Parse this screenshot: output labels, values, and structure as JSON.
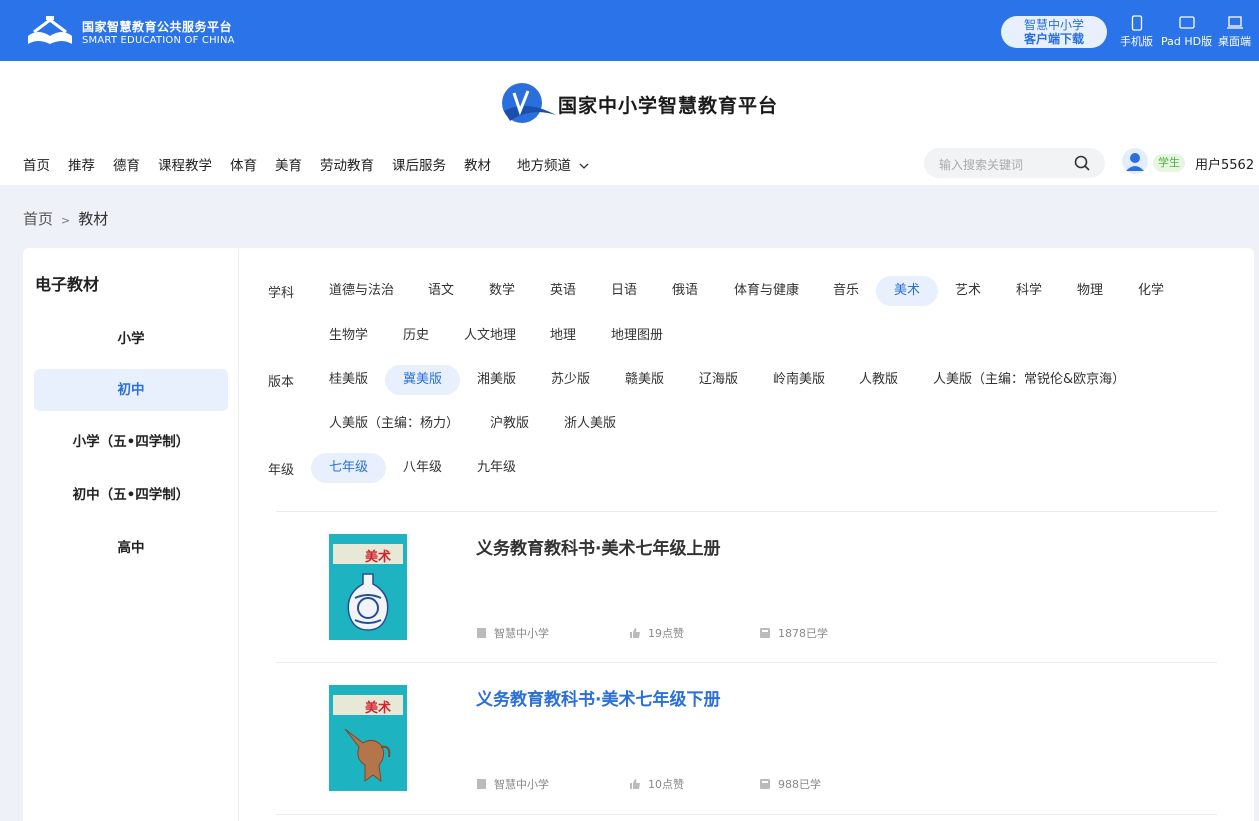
{
  "topbar": {
    "brand_cn": "国家智慧教育公共服务平台",
    "brand_en": "SMART EDUCATION OF CHINA",
    "download_line1": "智慧中小学",
    "download_line2": "客户端下载",
    "devices": [
      {
        "label": "手机版",
        "icon": "phone-icon"
      },
      {
        "label": "Pad HD版",
        "icon": "tablet-icon"
      },
      {
        "label": "桌面端",
        "icon": "laptop-icon"
      }
    ],
    "bg_color": "#2a73e8"
  },
  "header": {
    "title": "国家中小学智慧教育平台",
    "nav": [
      "首页",
      "推荐",
      "德育",
      "课程教学",
      "体育",
      "美育",
      "劳动教育",
      "课后服务",
      "教材",
      "地方频道"
    ],
    "search_placeholder": "输入搜索关键词",
    "role": "学生",
    "username": "用户5562"
  },
  "breadcrumb": {
    "home": "首页",
    "sep": ">",
    "current": "教材"
  },
  "sidebar": {
    "title": "电子教材",
    "items": [
      {
        "label": "小学",
        "active": false
      },
      {
        "label": "初中",
        "active": true
      },
      {
        "label": "小学（五•四学制）",
        "active": false
      },
      {
        "label": "初中（五•四学制）",
        "active": false
      },
      {
        "label": "高中",
        "active": false
      }
    ]
  },
  "filters": {
    "subject_label": "学科",
    "subjects_row1": [
      "道德与法治",
      "语文",
      "数学",
      "英语",
      "日语",
      "俄语",
      "体育与健康",
      "音乐",
      "美术",
      "艺术",
      "科学",
      "物理",
      "化学"
    ],
    "subjects_row2": [
      "生物学",
      "历史",
      "人文地理",
      "地理",
      "地理图册"
    ],
    "subject_selected": "美术",
    "edition_label": "版本",
    "editions_row1": [
      "桂美版",
      "冀美版",
      "湘美版",
      "苏少版",
      "赣美版",
      "辽海版",
      "岭南美版",
      "人教版",
      "人美版（主编：常锐伦&欧京海）"
    ],
    "editions_row2": [
      "人美版（主编：杨力）",
      "沪教版",
      "浙人美版"
    ],
    "edition_selected": "冀美版",
    "grade_label": "年级",
    "grades": [
      "七年级",
      "八年级",
      "九年级"
    ],
    "grade_selected": "七年级"
  },
  "books": [
    {
      "title": "义务教育教科书·美术七年级上册",
      "source": "智慧中小学",
      "likes": "19点赞",
      "learned": "1878已学",
      "cover_text": "美术"
    },
    {
      "title": "义务教育教科书·美术七年级下册",
      "source": "智慧中小学",
      "likes": "10点赞",
      "learned": "988已学",
      "cover_text": "美术"
    }
  ],
  "colors": {
    "accent": "#2a6fdb",
    "active_bg": "#e8f0fd",
    "cover": "#1db3c0"
  }
}
